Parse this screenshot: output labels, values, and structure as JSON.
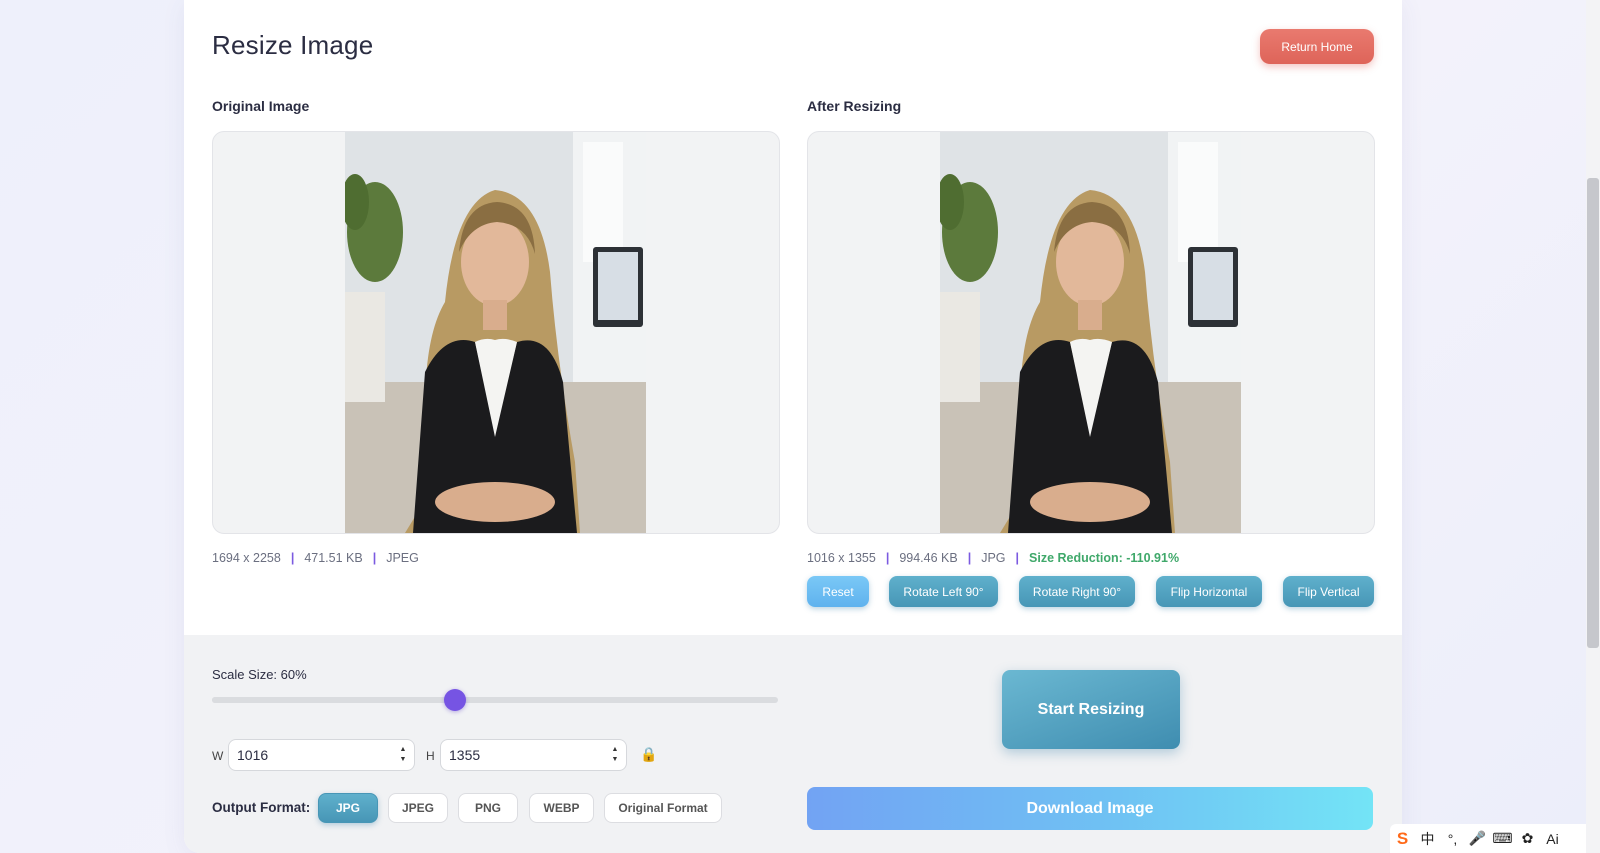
{
  "page": {
    "title": "Resize Image",
    "return_home": "Return Home"
  },
  "original": {
    "heading": "Original Image",
    "dimensions": "1694 x 2258",
    "size": "471.51 KB",
    "format": "JPEG"
  },
  "resized": {
    "heading": "After Resizing",
    "dimensions": "1016 x 1355",
    "size": "994.46 KB",
    "format": "JPG",
    "reduction": "Size Reduction: -110.91%"
  },
  "separator": "|",
  "tools": {
    "reset": "Reset",
    "rotate_left": "Rotate Left 90°",
    "rotate_right": "Rotate Right 90°",
    "flip_horizontal": "Flip Horizontal",
    "flip_vertical": "Flip Vertical"
  },
  "controls": {
    "scale_label": "Scale Size: 60%",
    "scale_value": 60,
    "width_label": "W",
    "width_value": "1016",
    "height_label": "H",
    "height_value": "1355",
    "output_label": "Output Format:",
    "formats": [
      "JPG",
      "JPEG",
      "PNG",
      "WEBP",
      "Original Format"
    ],
    "selected_format": "JPG",
    "start": "Start Resizing",
    "download": "Download Image"
  },
  "tray": {
    "items": [
      "S",
      "中",
      "°,",
      "mic-icon",
      "keyboard-icon",
      "skin-icon",
      "Ai"
    ]
  },
  "colors": {
    "accent_purple": "#7654e3",
    "teal_button": "#4796b6",
    "home_button": "#e06a5e",
    "reduction_green": "#3fa86a"
  }
}
